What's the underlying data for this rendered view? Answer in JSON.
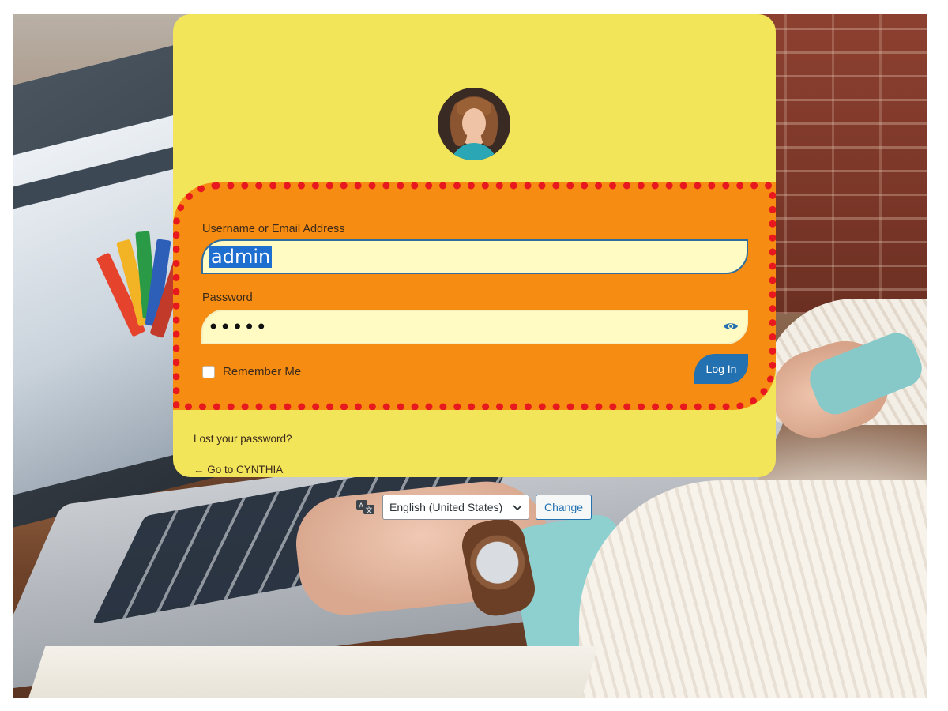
{
  "login": {
    "username_label": "Username or Email Address",
    "username_value": "admin",
    "password_label": "Password",
    "password_masked": "•••••",
    "remember_label": "Remember Me",
    "submit_label": "Log In",
    "lost_password_link": "Lost your password?",
    "back_to_site_link": "← Go to CYNTHIA"
  },
  "language": {
    "selected": "English (United States)",
    "change_label": "Change",
    "icon": "translate-icon"
  },
  "colors": {
    "card_background": "#f2e55a",
    "form_background": "#f68c11",
    "form_border_dots": "#e8181f",
    "field_background": "#fffbc2",
    "primary_button": "#2371b1",
    "text_highlight": "#1f6fd1"
  },
  "icons": {
    "show_password": "eye-icon",
    "select_arrow": "chevron-down-icon"
  }
}
